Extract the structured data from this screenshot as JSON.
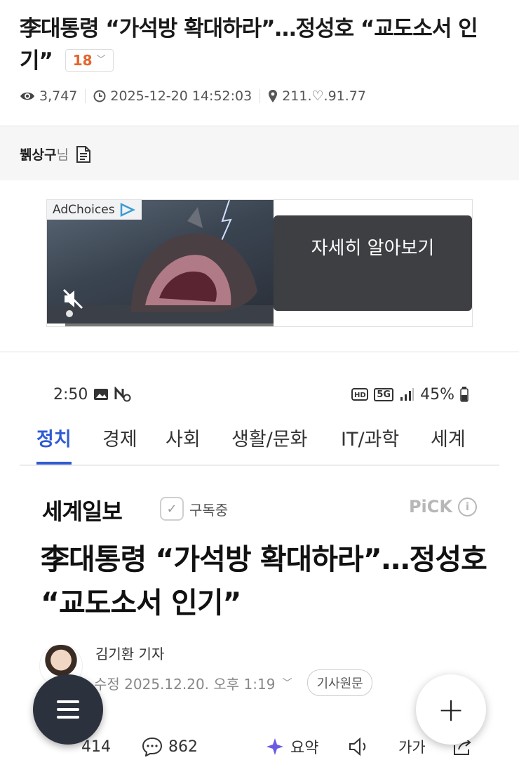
{
  "post": {
    "title": "李대통령 “가석방 확대하라”…정성호 “교도소서 인기”",
    "comment_count": "18",
    "views": "3,747",
    "datetime": "2025-12-20 14:52:03",
    "ip": "211.♡.91.77"
  },
  "author": {
    "name": "뷁상구",
    "suffix": "님"
  },
  "ad": {
    "choices_label": "AdChoices",
    "button_label": "자세히 알아보기"
  },
  "status_bar": {
    "time": "2:50",
    "battery": "45%",
    "network": "5G"
  },
  "nav_tabs": [
    {
      "label": "정치"
    },
    {
      "label": "경제"
    },
    {
      "label": "사회"
    },
    {
      "label": "생활/문화"
    },
    {
      "label": "IT/과학"
    },
    {
      "label": "세계"
    }
  ],
  "article": {
    "press": "세계일보",
    "subscribed_label": "구독중",
    "pick_label": "PiCK",
    "headline": "李대통령 “가석방 확대하라”…정성호 “교도소서 인기”",
    "reporter": "김기환 기자",
    "modified": "수정 2025.12.20. 오후 1:19",
    "source_button": "기사원문"
  },
  "actions": {
    "reactions": "414",
    "comments": "862",
    "summary": "요약",
    "font_size": "가가"
  },
  "colors": {
    "accent": "#2f5bd3",
    "comment_count": "#e4652b",
    "fab": "#2b323d"
  }
}
